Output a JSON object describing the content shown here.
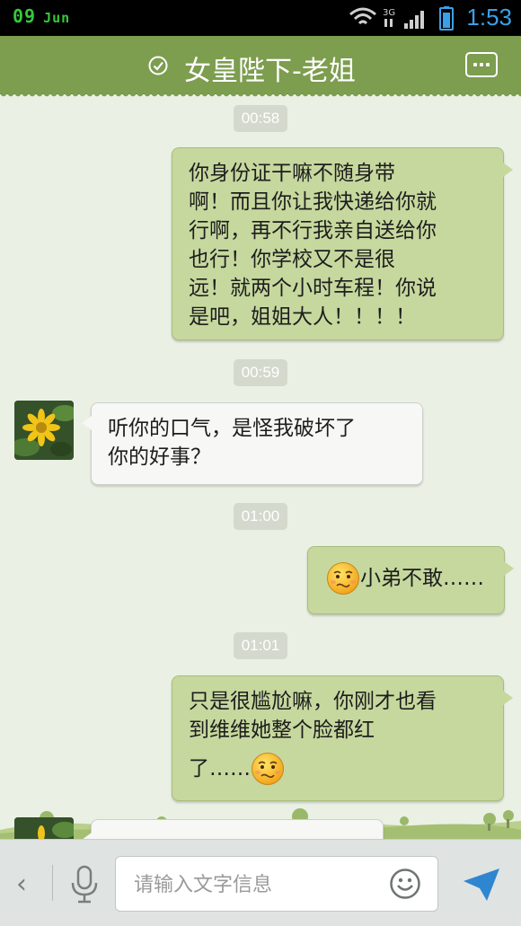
{
  "status_bar": {
    "date_day": "09",
    "date_month": "Jun",
    "network": "3G",
    "time": "1:53",
    "accent_time": "#3aa0e8",
    "accent_date": "#35c83a"
  },
  "header": {
    "title": "女皇陛下-老姐",
    "icons": [
      "check-circle-icon",
      "more-icon"
    ],
    "color": "#7d9d4f"
  },
  "messages": [
    {
      "type": "timestamp",
      "text": "00:58"
    },
    {
      "type": "outgoing",
      "lines": [
        "你身份证干嘛不随身带",
        "啊！而且你让我快递给你就",
        "行啊，再不行我亲自送给你",
        "也行！你学校又不是很",
        "远！就两个小时车程！你说",
        "是吧，姐姐大人！！！！"
      ]
    },
    {
      "type": "timestamp",
      "text": "00:59"
    },
    {
      "type": "incoming",
      "lines": [
        "听你的口气，是怪我破坏了",
        "你的好事？"
      ]
    },
    {
      "type": "timestamp",
      "text": "01:00"
    },
    {
      "type": "outgoing",
      "emoji": "embarrassed-emoji",
      "text": "小弟不敢……"
    },
    {
      "type": "timestamp",
      "text": "01:01"
    },
    {
      "type": "outgoing",
      "lines": [
        "只是很尴尬嘛，你刚才也看",
        "到维维她整个脸都红"
      ],
      "last_line": "了……",
      "emoji": "embarrassed-emoji"
    }
  ],
  "input_bar": {
    "back_label": "‹",
    "placeholder": "请输入文字信息",
    "icons": [
      "back-chevron-icon",
      "microphone-icon",
      "smiley-icon",
      "send-icon"
    ]
  },
  "colors": {
    "outgoing_bubble": "#c6d89e",
    "incoming_bubble": "#f7f7f5",
    "chat_background": "#eaf0e3"
  }
}
